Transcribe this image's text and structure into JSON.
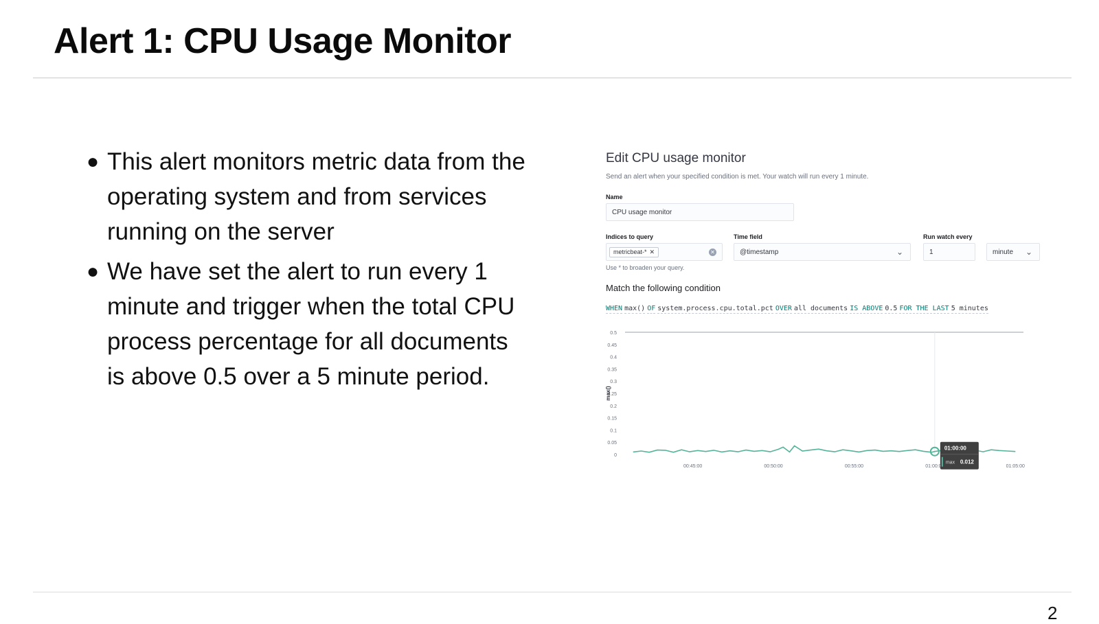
{
  "slide": {
    "title": "Alert 1: CPU Usage Monitor",
    "page_number": "2",
    "bullets": [
      "This alert monitors metric data from the operating system and from services running on the server",
      "We have set the alert to run every 1 minute and trigger when the total CPU process percentage for all documents is above 0.5 over a 5 minute period."
    ]
  },
  "monitor": {
    "title": "Edit CPU usage monitor",
    "description": "Send an alert when your specified condition is met. Your watch will run every 1 minute.",
    "name_label": "Name",
    "name_value": "CPU usage monitor",
    "indices_label": "Indices to query",
    "index_pill": "metricbeat-*",
    "indices_help": "Use * to broaden your query.",
    "time_field_label": "Time field",
    "time_field_value": "@timestamp",
    "run_every_label": "Run watch every",
    "run_every_value": "1",
    "run_every_unit": "minute",
    "condition_title": "Match the following condition",
    "expression": {
      "when": "WHEN",
      "agg": "max()",
      "of": "OF",
      "field": "system.process.cpu.total.pct",
      "over": "OVER",
      "scope": "all documents",
      "threshold_op": "IS ABOVE",
      "threshold": "0.5",
      "for_the_last": "FOR THE LAST",
      "window": "5 minutes"
    }
  },
  "colors": {
    "series": "#54b399",
    "threshold": "#9aa0a8",
    "tooltip_bg": "#404040"
  },
  "chart_data": {
    "type": "line",
    "ylabel": "max()",
    "ylim": [
      0,
      0.5
    ],
    "yticks": [
      "0",
      "0.05",
      "0.1",
      "0.15",
      "0.2",
      "0.25",
      "0.3",
      "0.35",
      "0.4",
      "0.45",
      "0.5"
    ],
    "xlim_minutes": [
      40.8,
      65.5
    ],
    "xticks": [
      {
        "label": "00:45:00",
        "minute": 45
      },
      {
        "label": "00:50:00",
        "minute": 50
      },
      {
        "label": "00:55:00",
        "minute": 55
      },
      {
        "label": "01:00:00",
        "minute": 60
      },
      {
        "label": "01:05:00",
        "minute": 65
      }
    ],
    "threshold": 0.5,
    "series": [
      {
        "x_minutes": [
          41.3,
          41.8,
          42.3,
          42.8,
          43.3,
          43.8,
          44.3,
          44.8,
          45.3,
          45.8,
          46.3,
          46.8,
          47.3,
          47.8,
          48.3,
          48.8,
          49.3,
          49.8,
          50.3,
          50.6,
          51.0,
          51.3,
          51.8,
          52.3,
          52.8,
          53.3,
          53.8,
          54.3,
          54.8,
          55.3,
          55.8,
          56.3,
          56.8,
          57.3,
          57.8,
          58.3,
          58.8,
          59.3,
          59.8,
          60.0,
          60.5,
          61.0,
          61.5,
          62.0,
          62.5,
          63.0,
          63.5,
          64.0,
          64.5,
          65.0
        ],
        "values": [
          0.01,
          0.014,
          0.009,
          0.018,
          0.017,
          0.009,
          0.019,
          0.011,
          0.016,
          0.012,
          0.017,
          0.01,
          0.015,
          0.011,
          0.018,
          0.013,
          0.016,
          0.011,
          0.021,
          0.03,
          0.01,
          0.035,
          0.014,
          0.018,
          0.022,
          0.015,
          0.011,
          0.019,
          0.015,
          0.01,
          0.016,
          0.018,
          0.013,
          0.015,
          0.012,
          0.016,
          0.019,
          0.013,
          0.009,
          0.012,
          0.017,
          0.011,
          0.01,
          0.013,
          0.017,
          0.011,
          0.019,
          0.016,
          0.014,
          0.012
        ]
      }
    ],
    "tooltip": {
      "time": "01:00:00",
      "label": "max",
      "value": "0.012",
      "x_minute": 60.0
    }
  }
}
